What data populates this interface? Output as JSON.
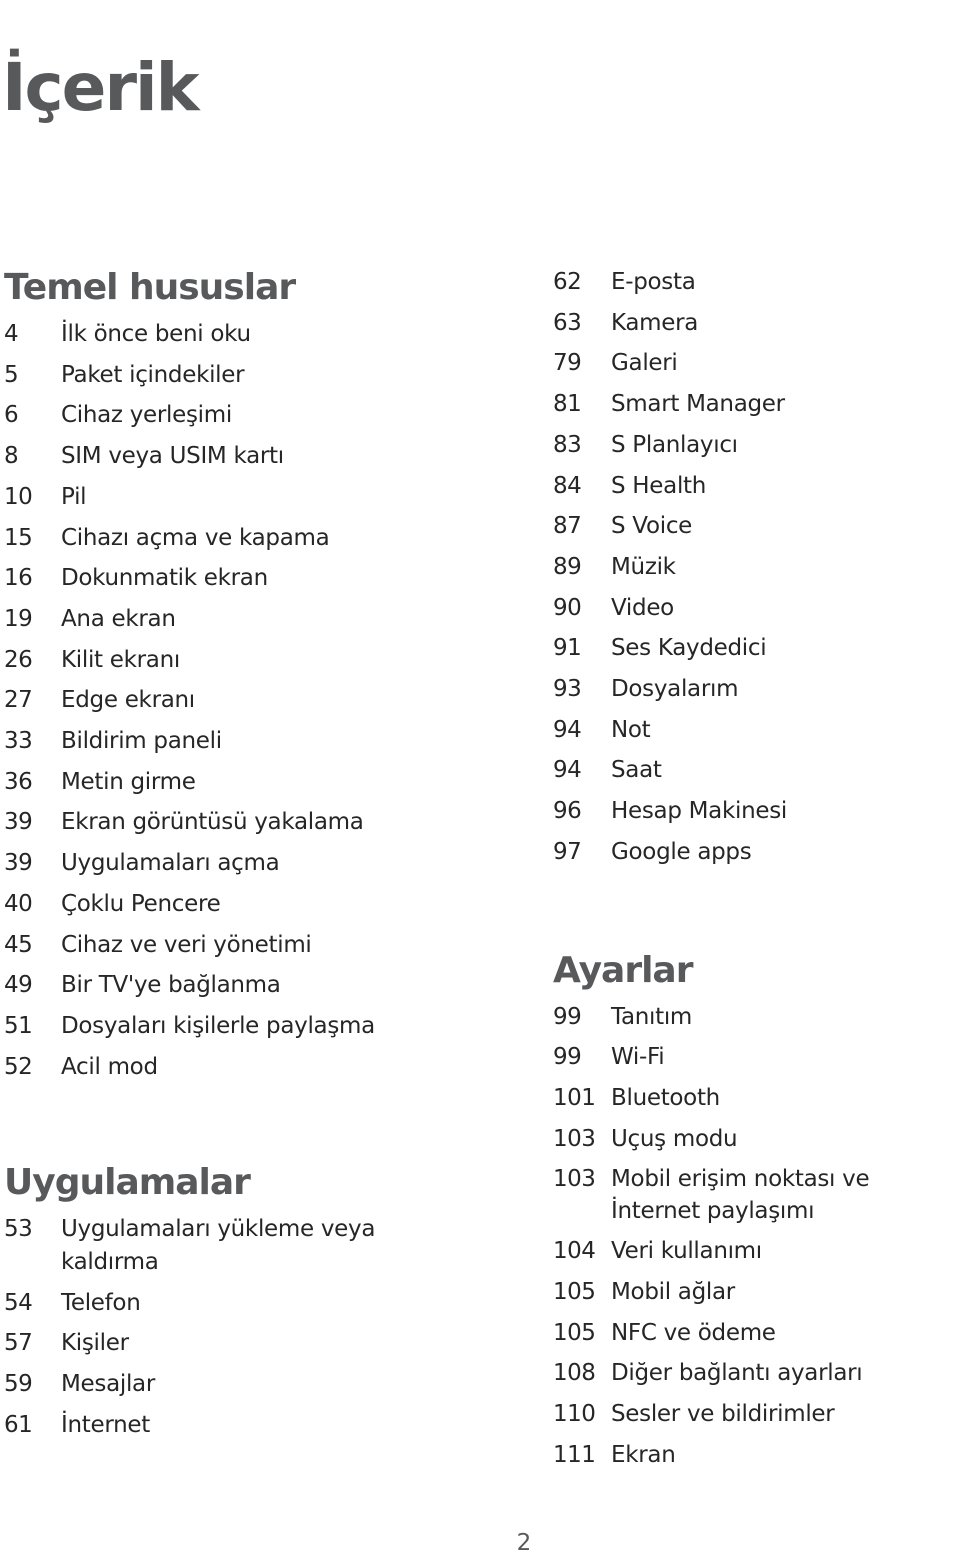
{
  "title": "İçerik",
  "page_number": "2",
  "sections": {
    "temel": {
      "heading": "Temel hususlar",
      "items": [
        {
          "page": "4",
          "label": "İlk önce beni oku"
        },
        {
          "page": "5",
          "label": "Paket içindekiler"
        },
        {
          "page": "6",
          "label": "Cihaz yerleşimi"
        },
        {
          "page": "8",
          "label": "SIM veya USIM kartı"
        },
        {
          "page": "10",
          "label": "Pil"
        },
        {
          "page": "15",
          "label": "Cihazı açma ve kapama"
        },
        {
          "page": "16",
          "label": "Dokunmatik ekran"
        },
        {
          "page": "19",
          "label": "Ana ekran"
        },
        {
          "page": "26",
          "label": "Kilit ekranı"
        },
        {
          "page": "27",
          "label": "Edge ekranı"
        },
        {
          "page": "33",
          "label": "Bildirim paneli"
        },
        {
          "page": "36",
          "label": "Metin girme"
        },
        {
          "page": "39",
          "label": "Ekran görüntüsü yakalama"
        },
        {
          "page": "39",
          "label": "Uygulamaları açma"
        },
        {
          "page": "40",
          "label": "Çoklu Pencere"
        },
        {
          "page": "45",
          "label": "Cihaz ve veri yönetimi"
        },
        {
          "page": "49",
          "label": "Bir TV'ye bağlanma"
        },
        {
          "page": "51",
          "label": "Dosyaları kişilerle paylaşma"
        },
        {
          "page": "52",
          "label": "Acil mod"
        }
      ]
    },
    "uygulamalar": {
      "heading": "Uygulamalar",
      "items": [
        {
          "page": "53",
          "label": "Uygulamaları yükleme veya kaldırma"
        },
        {
          "page": "54",
          "label": "Telefon"
        },
        {
          "page": "57",
          "label": "Kişiler"
        },
        {
          "page": "59",
          "label": "Mesajlar"
        },
        {
          "page": "61",
          "label": "İnternet"
        }
      ]
    },
    "uygulamalar_cont": {
      "items": [
        {
          "page": "62",
          "label": "E-posta"
        },
        {
          "page": "63",
          "label": "Kamera"
        },
        {
          "page": "79",
          "label": "Galeri"
        },
        {
          "page": "81",
          "label": "Smart Manager"
        },
        {
          "page": "83",
          "label": "S Planlayıcı"
        },
        {
          "page": "84",
          "label": "S Health"
        },
        {
          "page": "87",
          "label": "S Voice"
        },
        {
          "page": "89",
          "label": "Müzik"
        },
        {
          "page": "90",
          "label": "Video"
        },
        {
          "page": "91",
          "label": "Ses Kaydedici"
        },
        {
          "page": "93",
          "label": "Dosyalarım"
        },
        {
          "page": "94",
          "label": "Not"
        },
        {
          "page": "94",
          "label": "Saat"
        },
        {
          "page": "96",
          "label": "Hesap Makinesi"
        },
        {
          "page": "97",
          "label": "Google apps"
        }
      ]
    },
    "ayarlar": {
      "heading": "Ayarlar",
      "items": [
        {
          "page": "99",
          "label": "Tanıtım"
        },
        {
          "page": "99",
          "label": "Wi-Fi"
        },
        {
          "page": "101",
          "label": "Bluetooth"
        },
        {
          "page": "103",
          "label": "Uçuş modu"
        },
        {
          "page": "103",
          "label": "Mobil erişim noktası ve İnternet paylaşımı"
        },
        {
          "page": "104",
          "label": "Veri kullanımı"
        },
        {
          "page": "105",
          "label": "Mobil ağlar"
        },
        {
          "page": "105",
          "label": "NFC ve ödeme"
        },
        {
          "page": "108",
          "label": "Diğer bağlantı ayarları"
        },
        {
          "page": "110",
          "label": "Sesler ve bildirimler"
        },
        {
          "page": "111",
          "label": "Ekran"
        }
      ]
    }
  }
}
